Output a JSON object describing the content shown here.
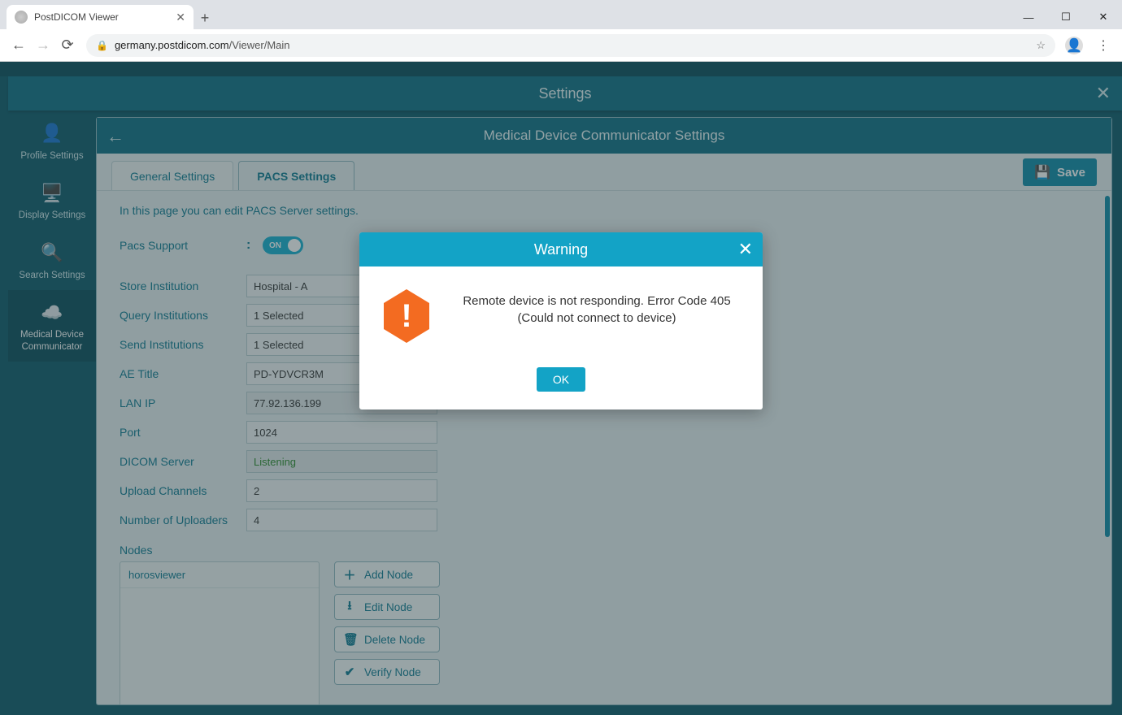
{
  "browser": {
    "tab_title": "PostDICOM Viewer",
    "url_host": "germany.postdicom.com",
    "url_path": "/Viewer/Main"
  },
  "settings_modal": {
    "title": "Settings",
    "sidebar": [
      {
        "icon": "person-icon",
        "label": "Profile Settings"
      },
      {
        "icon": "display-icon",
        "label": "Display Settings"
      },
      {
        "icon": "search-icon",
        "label": "Search Settings"
      },
      {
        "icon": "cloud-icon",
        "label": "Medical Device Communicator"
      }
    ],
    "panel_title": "Medical Device Communicator Settings",
    "tabs": {
      "general": "General Settings",
      "pacs": "PACS Settings"
    },
    "save_label": "Save",
    "intro": "In this page you can edit PACS Server settings.",
    "fields": {
      "pacs_support_label": "Pacs Support",
      "pacs_support_value": "ON",
      "store_institution_label": "Store Institution",
      "store_institution_value": "Hospital - A",
      "query_institutions_label": "Query Institutions",
      "query_institutions_value": "1 Selected",
      "send_institutions_label": "Send Institutions",
      "send_institutions_value": "1 Selected",
      "ae_title_label": "AE Title",
      "ae_title_value": "PD-YDVCR3M",
      "lan_ip_label": "LAN IP",
      "lan_ip_value": "77.92.136.199",
      "port_label": "Port",
      "port_value": "1024",
      "dicom_server_label": "DICOM Server",
      "dicom_server_value": "Listening",
      "upload_channels_label": "Upload Channels",
      "upload_channels_value": "2",
      "num_uploaders_label": "Number of Uploaders",
      "num_uploaders_value": "4"
    },
    "nodes": {
      "label": "Nodes",
      "items": [
        "horosviewer"
      ],
      "add": "Add Node",
      "edit": "Edit Node",
      "delete": "Delete Node",
      "verify": "Verify Node"
    }
  },
  "warning": {
    "title": "Warning",
    "message_line1": "Remote device is not responding. Error Code 405",
    "message_line2": "(Could not connect to device)",
    "ok": "OK"
  }
}
